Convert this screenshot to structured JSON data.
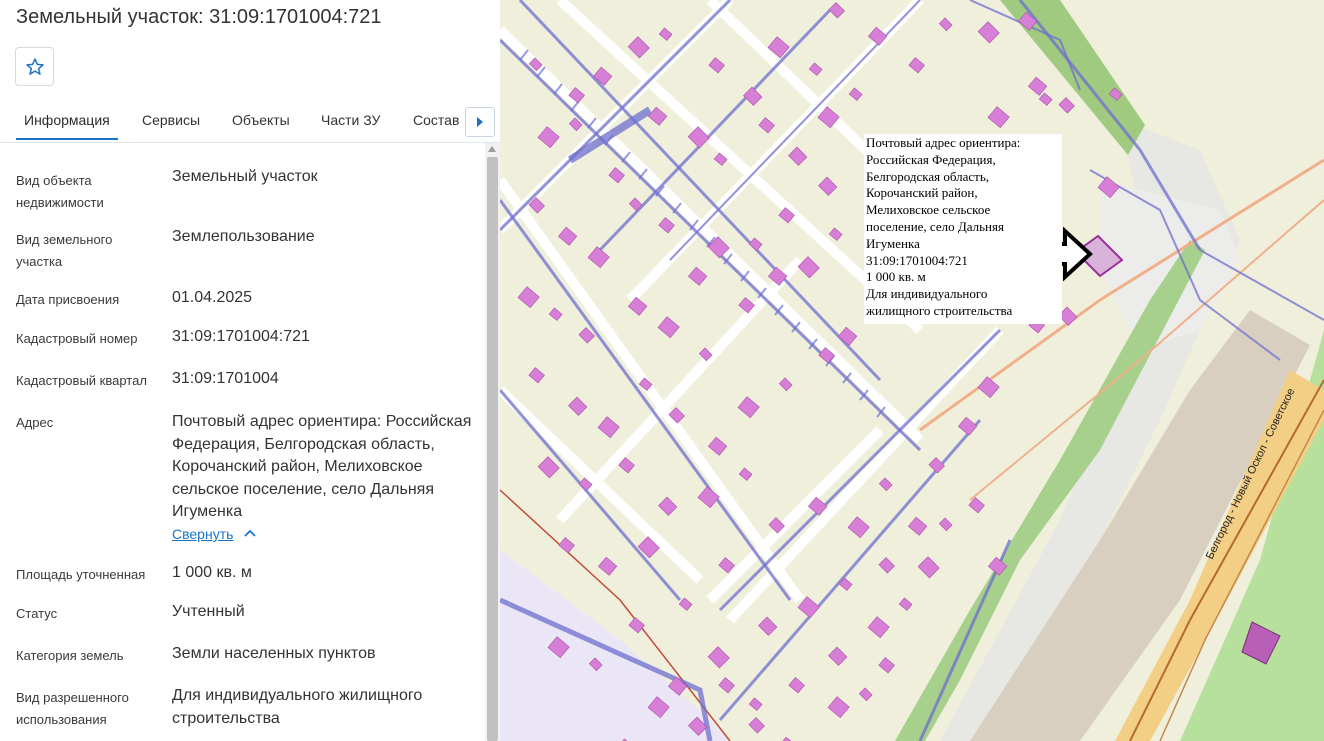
{
  "panel": {
    "title": "Земельный участок: 31:09:1701004:721",
    "tabs": [
      "Информация",
      "Сервисы",
      "Объекты",
      "Части ЗУ",
      "Состав"
    ],
    "fields": [
      {
        "label": "Вид объекта недвижимости",
        "value": "Земельный участок"
      },
      {
        "label": "Вид земельного участка",
        "value": "Землепользование"
      },
      {
        "label": "Дата присвоения",
        "value": "01.04.2025"
      },
      {
        "label": "Кадастровый номер",
        "value": "31:09:1701004:721"
      },
      {
        "label": "Кадастровый квартал",
        "value": "31:09:1701004"
      },
      {
        "label": "Адрес",
        "value": "Почтовый адрес ориентира: Российская Федерация, Белгородская область, Корочанский район, Мелиховское сельское поселение, село Дальняя Игуменка"
      },
      {
        "label": "Площадь уточненная",
        "value": "1 000 кв. м"
      },
      {
        "label": "Статус",
        "value": "Учтенный"
      },
      {
        "label": "Категория земель",
        "value": "Земли населенных пунктов"
      },
      {
        "label": "Вид разрешенного использования",
        "value": "Для индивидуального жилищного строительства"
      }
    ],
    "collapse_label": "Свернуть"
  },
  "map": {
    "popup_lines": [
      "Почтовый адрес ориентира:",
      "Российская Федерация,",
      "Белгородская область,",
      "Корочанский район,",
      "Мелиховское сельское",
      "поселение, село Дальняя",
      "Игуменка",
      "31:09:1701004:721",
      "1 000 кв. м",
      "Для индивидуального",
      "жилищного строительства"
    ],
    "road_label": "Белгород - Новый Оскол - Советское"
  },
  "colors": {
    "accent": "#1a73c8",
    "map_background": "#efefdc",
    "building": "#d77fd6",
    "utility_line": "#6e6ecf",
    "green_belt": "#99c97a",
    "highway": "#f2cd85"
  },
  "icons": {
    "favorite": "star-icon",
    "tabs_next": "chevron-right-icon",
    "collapse": "chevron-up-icon",
    "pointer": "arrow-right-icon"
  }
}
